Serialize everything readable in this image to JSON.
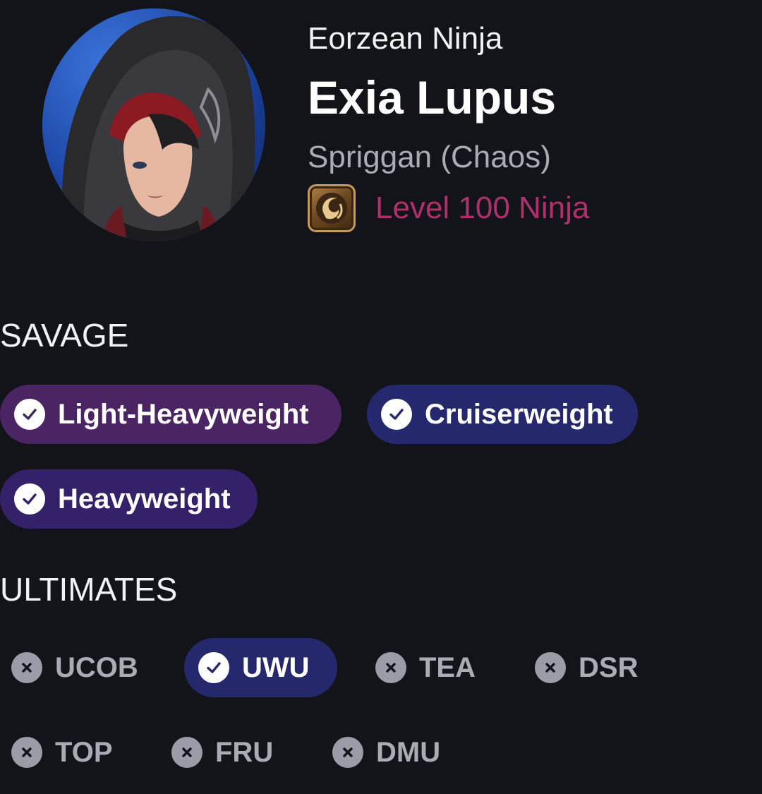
{
  "profile": {
    "title": "Eorzean Ninja",
    "name": "Exia Lupus",
    "world": "Spriggan (Chaos)",
    "job_label": "Level 100 Ninja",
    "job_icon": "ninja-job-icon",
    "job_color": "#b0306e"
  },
  "savage": {
    "heading": "SAVAGE",
    "items": [
      {
        "label": "Light-Heavyweight",
        "cleared": true,
        "color": "#4a2463"
      },
      {
        "label": "Cruiserweight",
        "cleared": true,
        "color": "#25286c"
      },
      {
        "label": "Heavyweight",
        "cleared": true,
        "color": "#34216a"
      }
    ]
  },
  "ultimates": {
    "heading": "ULTIMATES",
    "items": [
      {
        "label": "UCOB",
        "cleared": false
      },
      {
        "label": "UWU",
        "cleared": true,
        "color": "#25286c"
      },
      {
        "label": "TEA",
        "cleared": false
      },
      {
        "label": "DSR",
        "cleared": false
      },
      {
        "label": "TOP",
        "cleared": false
      },
      {
        "label": "FRU",
        "cleared": false
      },
      {
        "label": "DMU",
        "cleared": false
      }
    ]
  }
}
